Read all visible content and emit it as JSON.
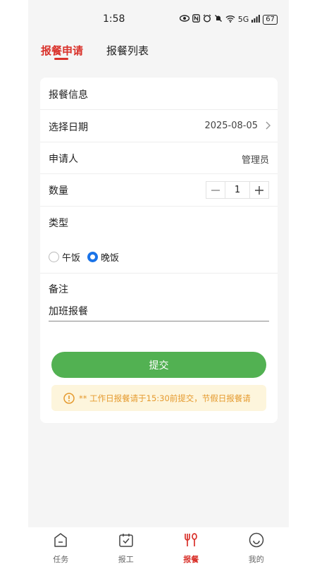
{
  "status": {
    "time": "1:58",
    "signal": "5G",
    "battery": "67"
  },
  "tabs": [
    {
      "label": "报餐申请"
    },
    {
      "label": "报餐列表"
    }
  ],
  "form": {
    "section_title": "报餐信息",
    "date": {
      "label": "选择日期",
      "value": "2025-08-05"
    },
    "applicant": {
      "label": "申请人",
      "value": "管理员"
    },
    "quantity": {
      "label": "数量",
      "value": "1"
    },
    "type": {
      "label": "类型",
      "options": [
        {
          "label": "午饭",
          "selected": false
        },
        {
          "label": "晚饭",
          "selected": true
        }
      ]
    },
    "remark": {
      "label": "备注",
      "value": "加班报餐"
    },
    "submit_label": "提交",
    "notice": "** 工作日报餐请于15:30前提交，节假日报餐请"
  },
  "nav": [
    {
      "label": "任务",
      "icon": "task-icon",
      "active": false
    },
    {
      "label": "报工",
      "icon": "calendar-check-icon",
      "active": false
    },
    {
      "label": "报餐",
      "icon": "fork-spoon-icon",
      "active": true
    },
    {
      "label": "我的",
      "icon": "smile-icon",
      "active": false
    }
  ],
  "colors": {
    "accent": "#d9322b",
    "submit": "#52b152",
    "radio": "#1a73e8",
    "notice_bg": "#fdf5dc",
    "notice_text": "#e59a2e"
  }
}
